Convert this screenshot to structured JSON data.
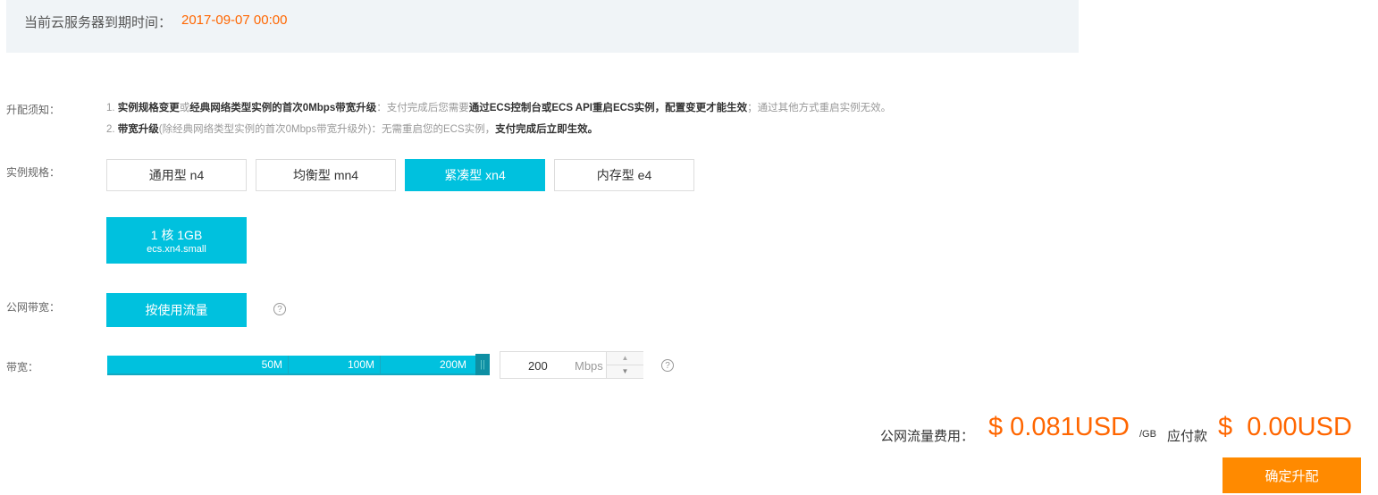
{
  "expiry": {
    "label": "当前云服务器到期时间：",
    "value": "2017-09-07 00:00"
  },
  "notes": {
    "label": "升配须知：",
    "line1": [
      "1. ",
      "实例规格变更",
      "或",
      "经典网络类型实例的首次0Mbps带宽升级",
      "：支付完成后您需要",
      "通过ECS控制台或ECS API重启ECS实例，配置变更才能生效",
      "；通过其他方式重启实例无效。"
    ],
    "line2": [
      "2. ",
      "带宽升级",
      "(除经典网络类型实例的首次0Mbps带宽升级外)：无需重启您的ECS实例，",
      "支付完成后立即生效。"
    ]
  },
  "instance": {
    "label": "实例规格：",
    "families": [
      "通用型 n4",
      "均衡型 mn4",
      "紧凑型 xn4",
      "内存型 e4"
    ],
    "selected_family": 2,
    "spec": {
      "title": "1 核 1GB",
      "name": "ecs.xn4.small"
    }
  },
  "public_bw": {
    "label": "公网带宽：",
    "option": "按使用流量",
    "help": "?"
  },
  "bandwidth": {
    "label": "带宽：",
    "ticks": [
      "50M",
      "100M",
      "200M"
    ],
    "value": "200",
    "unit": "Mbps",
    "help": "?",
    "fill_percent": 100
  },
  "price": {
    "traffic_label": "公网流量费用：",
    "traffic_value": "$ 0.081USD",
    "per": "/GB",
    "due_label": "应付款",
    "due_value": "$  0.00USD",
    "colors": {
      "price": "#ff6600",
      "button": "#ff8a00",
      "accent": "#00c1de"
    }
  },
  "confirm": "确定升配"
}
